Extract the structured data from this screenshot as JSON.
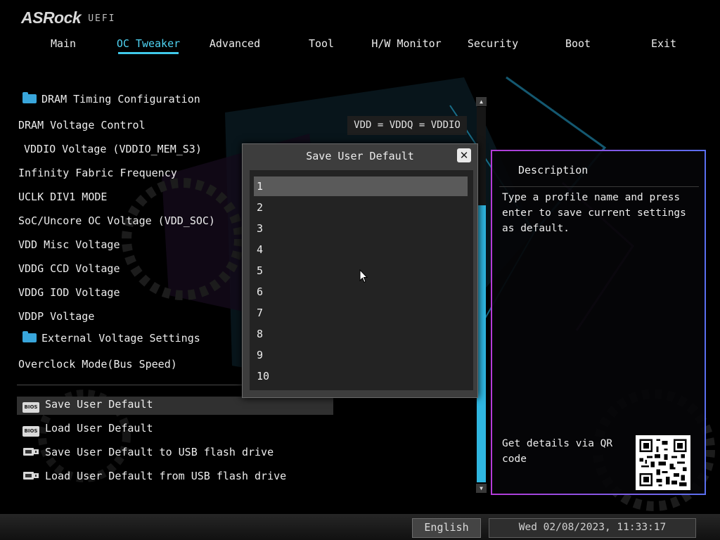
{
  "brand": {
    "name": "ASRock",
    "subtitle": "UEFI"
  },
  "tabs": [
    {
      "label": "Main"
    },
    {
      "label": "OC Tweaker",
      "active": true
    },
    {
      "label": "Advanced"
    },
    {
      "label": "Tool"
    },
    {
      "label": "H/W Monitor"
    },
    {
      "label": "Security"
    },
    {
      "label": "Boot"
    },
    {
      "label": "Exit"
    }
  ],
  "settings": {
    "dram_timing": "DRAM Timing Configuration",
    "dram_voltage_control": "DRAM Voltage Control",
    "dram_voltage_control_value": "VDD = VDDQ = VDDIO",
    "vddio_voltage": "VDDIO Voltage (VDDIO_MEM_S3)",
    "infinity_fabric": "Infinity Fabric Frequency",
    "uclk": "UCLK DIV1 MODE",
    "soc_voltage": "SoC/Uncore OC Voltage (VDD_SOC)",
    "vdd_misc": "VDD Misc Voltage",
    "vddg_ccd": "VDDG CCD Voltage",
    "vddg_iod": "VDDG IOD Voltage",
    "vddp": "VDDP Voltage",
    "external_voltage": "External Voltage Settings",
    "overclock_mode": "Overclock Mode(Bus Speed)",
    "save_user_default": "Save User Default",
    "load_user_default": "Load User Default",
    "save_usb": "Save User Default to USB flash drive",
    "load_usb": "Load User Default from USB flash drive"
  },
  "dialog": {
    "title": "Save User Default",
    "options": [
      "1",
      "2",
      "3",
      "4",
      "5",
      "6",
      "7",
      "8",
      "9",
      "10"
    ],
    "selected": "1"
  },
  "description": {
    "title": "Description",
    "text": "Type a profile name and press enter to save current settings as default.",
    "qr_text": "Get details via QR code"
  },
  "footer": {
    "language": "English",
    "datetime": "Wed 02/08/2023, 11:33:17"
  },
  "colors": {
    "accent": "#40c9ea",
    "folder": "#39a6db",
    "description_border_start": "#b53bd8",
    "description_border_end": "#5a6ff0"
  },
  "icons": [
    "folder-icon",
    "bios-chip-icon",
    "usb-drive-icon",
    "close-icon",
    "scroll-up-icon",
    "scroll-down-icon",
    "qr-code-icon",
    "mouse-cursor-icon"
  ]
}
